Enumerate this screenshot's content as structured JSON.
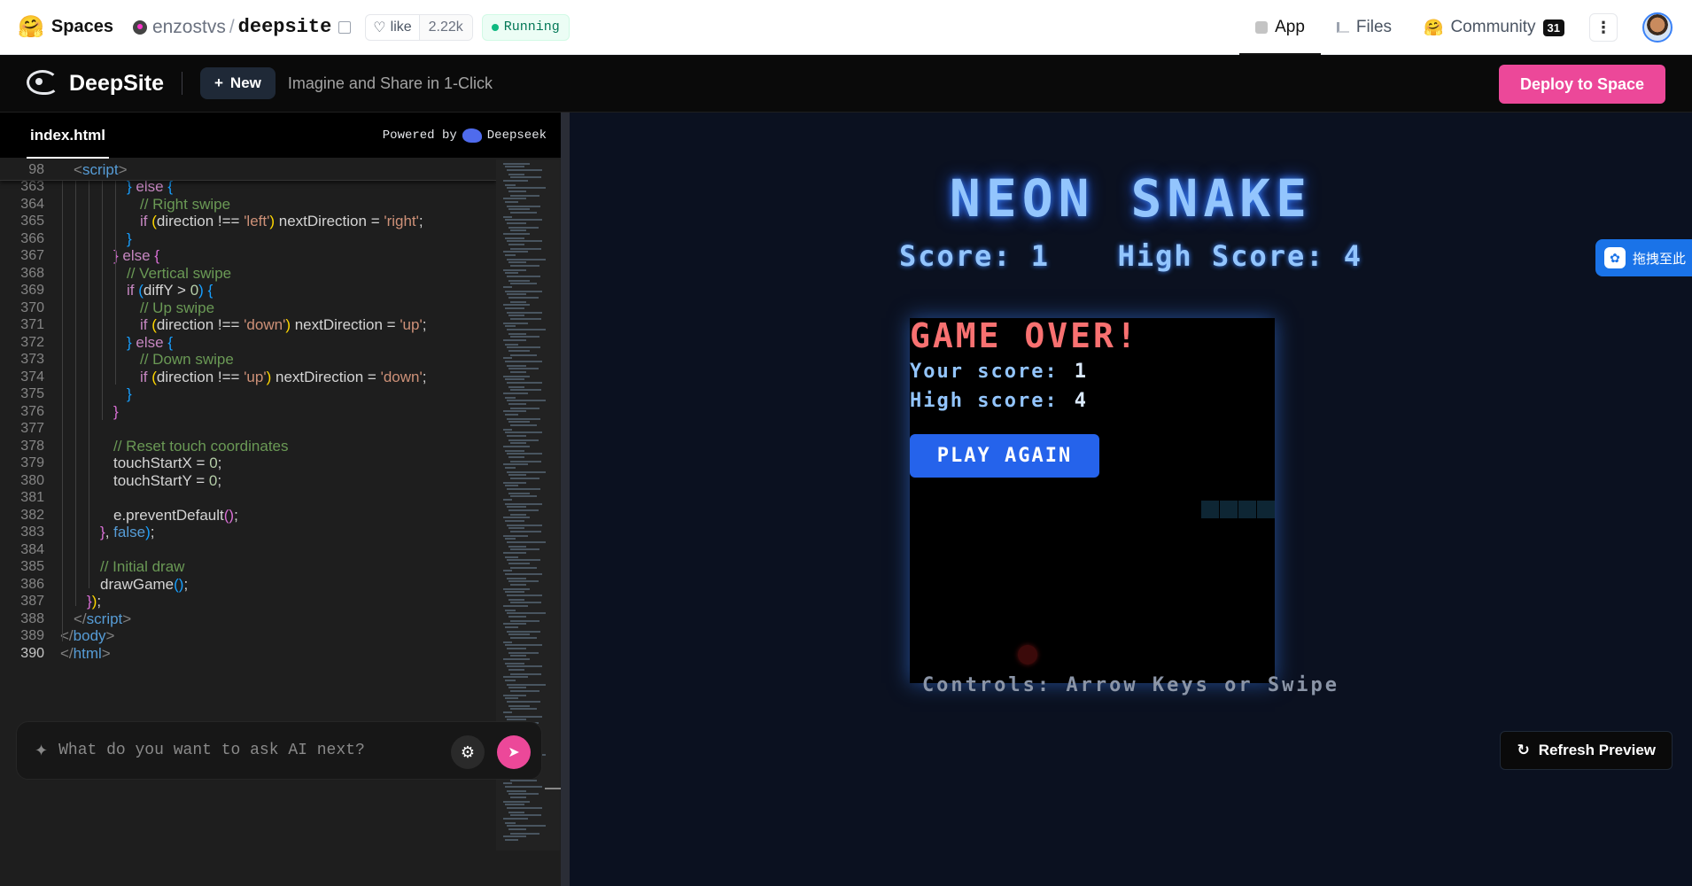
{
  "hf": {
    "brand": "Spaces",
    "owner": "enzostvs",
    "repo": "deepsite",
    "like_label": "like",
    "like_count": "2.22k",
    "status": "Running",
    "tabs": [
      {
        "label": "App",
        "icon": "cube-icon"
      },
      {
        "label": "Files",
        "icon": "files-icon"
      },
      {
        "label": "Community",
        "icon": "community-icon",
        "badge": "31"
      }
    ]
  },
  "deepsite": {
    "title": "DeepSite",
    "new_label": "New",
    "tagline": "Imagine and Share in 1-Click",
    "deploy_label": "Deploy to Space"
  },
  "editor": {
    "file_tab": "index.html",
    "powered_prefix": "Powered by",
    "powered_name": "Deepseek",
    "sticky": {
      "num": "98",
      "html": "<span class=\"tk-punc\">&lt;</span><span class=\"tk-tag\">script</span><span class=\"tk-punc\">&gt;</span>"
    },
    "lines": [
      {
        "num": "363",
        "indent": 5,
        "html": "<span class=\"tk-br3\">}</span> <span class=\"tk-ctl\">else</span> <span class=\"tk-br3\">{</span>"
      },
      {
        "num": "364",
        "indent": 6,
        "html": "<span class=\"tk-com\">// Right swipe</span>"
      },
      {
        "num": "365",
        "indent": 6,
        "html": "<span class=\"tk-ctl\">if</span> <span class=\"tk-br1\">(</span>direction !== <span class=\"tk-str\">'left'</span><span class=\"tk-br1\">)</span> nextDirection = <span class=\"tk-str\">'right'</span>;"
      },
      {
        "num": "366",
        "indent": 5,
        "html": "<span class=\"tk-br3\">}</span>"
      },
      {
        "num": "367",
        "indent": 4,
        "html": "<span class=\"tk-br2\">}</span> <span class=\"tk-ctl\">else</span> <span class=\"tk-br2\">{</span>"
      },
      {
        "num": "368",
        "indent": 5,
        "html": "<span class=\"tk-com\">// Vertical swipe</span>"
      },
      {
        "num": "369",
        "indent": 5,
        "html": "<span class=\"tk-ctl\">if</span> <span class=\"tk-br3\">(</span>diffY &gt; <span class=\"tk-num\">0</span><span class=\"tk-br3\">)</span> <span class=\"tk-br3\">{</span>"
      },
      {
        "num": "370",
        "indent": 6,
        "html": "<span class=\"tk-com\">// Up swipe</span>"
      },
      {
        "num": "371",
        "indent": 6,
        "html": "<span class=\"tk-ctl\">if</span> <span class=\"tk-br1\">(</span>direction !== <span class=\"tk-str\">'down'</span><span class=\"tk-br1\">)</span> nextDirection = <span class=\"tk-str\">'up'</span>;"
      },
      {
        "num": "372",
        "indent": 5,
        "html": "<span class=\"tk-br3\">}</span> <span class=\"tk-ctl\">else</span> <span class=\"tk-br3\">{</span>"
      },
      {
        "num": "373",
        "indent": 6,
        "html": "<span class=\"tk-com\">// Down swipe</span>"
      },
      {
        "num": "374",
        "indent": 6,
        "html": "<span class=\"tk-ctl\">if</span> <span class=\"tk-br1\">(</span>direction !== <span class=\"tk-str\">'up'</span><span class=\"tk-br1\">)</span> nextDirection = <span class=\"tk-str\">'down'</span>;"
      },
      {
        "num": "375",
        "indent": 5,
        "html": "<span class=\"tk-br3\">}</span>"
      },
      {
        "num": "376",
        "indent": 4,
        "html": "<span class=\"tk-br2\">}</span>"
      },
      {
        "num": "377",
        "indent": 0,
        "html": ""
      },
      {
        "num": "378",
        "indent": 4,
        "html": "<span class=\"tk-com\">// Reset touch coordinates</span>"
      },
      {
        "num": "379",
        "indent": 4,
        "html": "touchStartX = <span class=\"tk-num\">0</span>;"
      },
      {
        "num": "380",
        "indent": 4,
        "html": "touchStartY = <span class=\"tk-num\">0</span>;"
      },
      {
        "num": "381",
        "indent": 0,
        "html": ""
      },
      {
        "num": "382",
        "indent": 4,
        "html": "e.preventDefault<span class=\"tk-br2\">()</span>;"
      },
      {
        "num": "383",
        "indent": 3,
        "html": "<span class=\"tk-br2\">}</span>, <span class=\"tk-kw\">false</span><span class=\"tk-br3\">)</span>;"
      },
      {
        "num": "384",
        "indent": 0,
        "html": ""
      },
      {
        "num": "385",
        "indent": 3,
        "html": "<span class=\"tk-com\">// Initial draw</span>"
      },
      {
        "num": "386",
        "indent": 3,
        "html": "drawGame<span class=\"tk-br3\">()</span>;"
      },
      {
        "num": "387",
        "indent": 2,
        "html": "<span class=\"tk-br2\">}</span><span class=\"tk-br1\">)</span>;"
      },
      {
        "num": "388",
        "indent": 1,
        "html": "<span class=\"tk-punc\">&lt;/</span><span class=\"tk-tag\">script</span><span class=\"tk-punc\">&gt;</span>"
      },
      {
        "num": "389",
        "indent": 0,
        "html": "<span class=\"tk-punc\">&lt;/</span><span class=\"tk-tag\">body</span><span class=\"tk-punc\">&gt;</span>"
      },
      {
        "num": "390",
        "indent": 0,
        "current": true,
        "html": "<span class=\"tk-punc\">&lt;/</span><span class=\"tk-tag\">html</span><span class=\"tk-punc\">&gt;</span>"
      }
    ],
    "chat_placeholder": "What do you want to ask AI next?"
  },
  "game": {
    "title": "NEON SNAKE",
    "score_label": "Score:",
    "score": "1",
    "high_label": "High Score:",
    "high": "4",
    "over_title": "GAME OVER!",
    "your_score_label": "Your score:",
    "your_score": "1",
    "high_score_label": "High score:",
    "high_score": "4",
    "play_again": "PLAY AGAIN",
    "controls": "Controls: Arrow Keys or Swipe"
  },
  "preview": {
    "refresh_label": "Refresh Preview",
    "ext_text": "拖拽至此"
  },
  "colors": {
    "accent_pink": "#ec4899",
    "neon_blue": "#93c5fd",
    "game_over_red": "#f87171",
    "play_blue": "#2563eb",
    "running_green": "#10b981"
  }
}
